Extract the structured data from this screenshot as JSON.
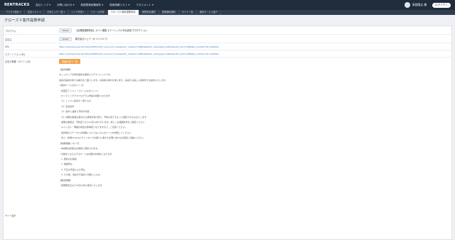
{
  "app": {
    "logo": "RENTRACKS"
  },
  "top_menu": [
    "会社トップ ▾",
    "お問い合わせ ▾",
    "新規提案依頼案件 ▾",
    "提案依頼リスト ▾",
    "マネジメント ▾"
  ],
  "user": {
    "name": "高田隆吉 様",
    "logout_label": "ログアウト"
  },
  "tabs": [
    {
      "label": "アクセス統計 ▾",
      "active": false
    },
    {
      "label": "広告リスト ▾",
      "active": false
    },
    {
      "label": "お気に入り一覧 ▾",
      "active": false
    },
    {
      "label": "リンク作成 ▾",
      "active": false
    },
    {
      "label": "フォーム作成",
      "active": false
    },
    {
      "label": "クローズド案件提携申請",
      "active": true
    },
    {
      "label": "提携申請通知",
      "active": false
    },
    {
      "label": "提携解除通知",
      "active": false
    },
    {
      "label": "サイト一覧",
      "active": false
    },
    {
      "label": "報告サービス紹介",
      "active": false
    }
  ],
  "page": {
    "title": "クローズド案件提携申請"
  },
  "fields": {
    "program": {
      "label": "プログラム",
      "chip": "70101",
      "value": "【全規模通販特化】オリジ通販【ベーシック】申込仮仮プロダクション"
    },
    "advertiser": {
      "label": "広告主",
      "chip": "10421",
      "value": "株式会社ジェア（オリジナルア）"
    },
    "url": {
      "label": "URL",
      "value": "https://rentracks.jpn.kbc/link/a35871/utm_source=rt_deals/utm_medium=affiliate&utm_campaign=nettradeutm_term=affiliate_content=rtt_link0001"
    },
    "sp_url": {
      "label": "スマートフォンURL",
      "value": "https://rentracks.jpn.kbc/link/a35871/utm_source=rt_deals/utm_medium=affiliate&utm_campaign=nettradeutm_term=affiliate_content=rtt_link0001"
    },
    "description": {
      "label": "広告の概要（サイト上位）",
      "button": "詳細を見て一覧",
      "lines": [
        "【案件概要】",
        "ネットクレアの特化型的な販売エステクリニックです。",
        "従来の医療の新たな魅力をご紹介します。お客様の幸せを常に考え、喜ばれる美しい身体作りを提供いたします。",
        "",
        "【案件ルールのポイント】",
        "・初回完了リスト（フォームのポイント）",
        "・オンライングラマプログラム参加の成果となります",
        "　（1）とリスト集計の一部となる",
        "　（2）定性条件",
        "　（3）案件と連携で予約が可能",
        "　（4）成果の確認は受付から通知を受け取り、予約の完了をもって確定されるものとします",
        "　成果の確認は、予約完了から14日以内に行います。詳しくは報酬条件をご確認ください",
        "　キャンセル・重複の場合は非承認となりますので、ご注意ください。",
        "　案件毎のステータスの詳細についてはこちらのページを参照してください",
        "　また、新規Youtuberチャンネルでの紹介に関するお問い合わせは別途ご連絡ください。",
        "",
        "【成果報酬について】",
        "・本成果は初回のお客様に限定されます。",
        "・対象外となる以下のケースは成果の対象外となります",
        "　1. 既存のお客様",
        "　2. 重複申込",
        "　3. 不正な手段による申込",
        "　4. その他、当社が不適切と判断したもの",
        "【確定時期】",
        "・成果発生日より45日以内に確定いたします",
        "",
        "",
        "",
        "",
        "",
        "",
        "",
        "",
        "",
        "",
        ""
      ]
    },
    "bottom_label": "サイト紹介"
  }
}
